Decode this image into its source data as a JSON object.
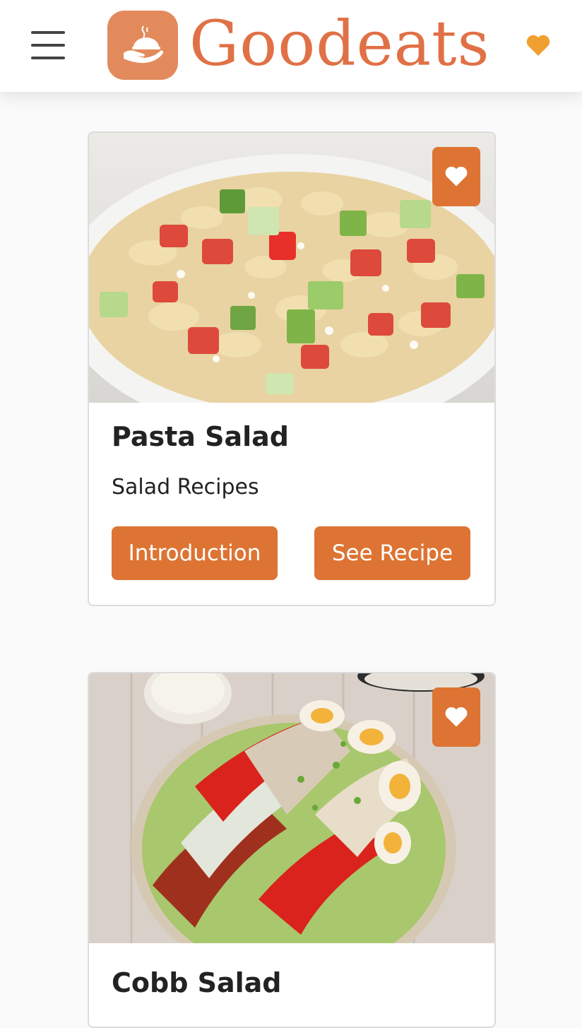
{
  "header": {
    "app_name": "Goodeats",
    "menu_icon": "hamburger-menu-icon",
    "favorites_icon": "heart-icon",
    "logo_icon": "hand-holding-dish-icon"
  },
  "colors": {
    "brand": "#e07146",
    "button": "#dd7433",
    "favorites_heart": "#f0a030"
  },
  "recipes": [
    {
      "title": "Pasta Salad",
      "category": "Salad Recipes",
      "intro_label": "Introduction",
      "recipe_label": "See Recipe",
      "favorite_icon": "heart-icon"
    },
    {
      "title": "Cobb Salad",
      "favorite_icon": "heart-icon"
    }
  ]
}
